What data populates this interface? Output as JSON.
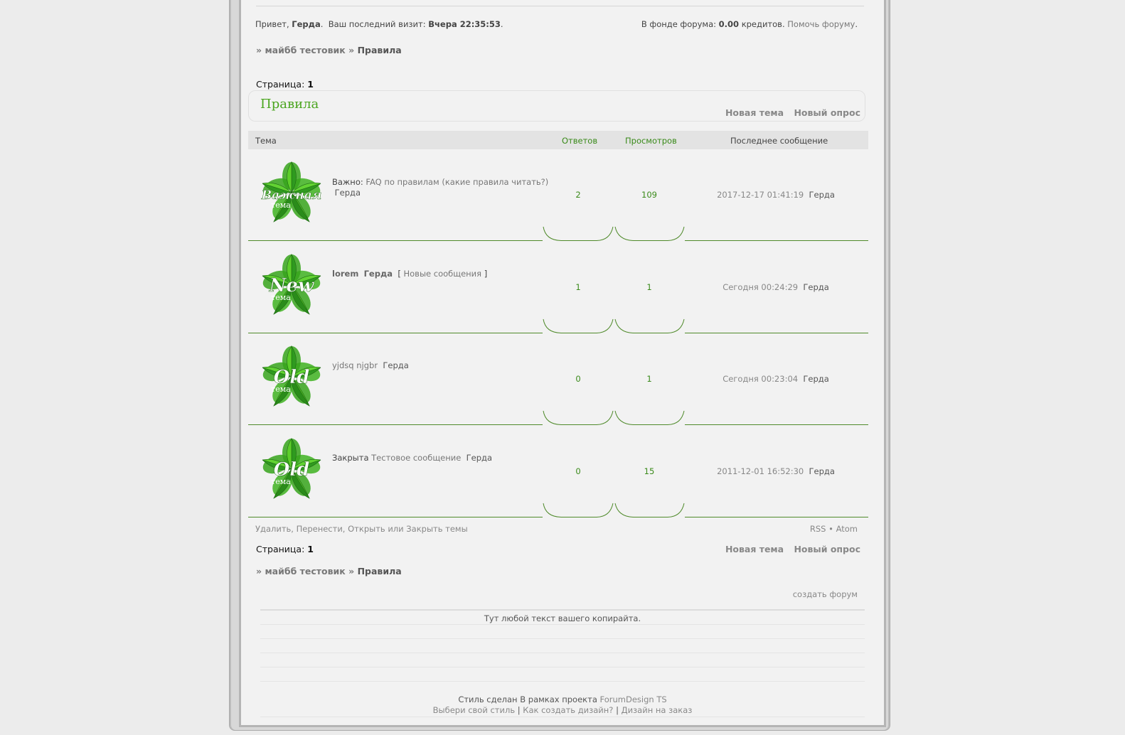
{
  "header": {
    "greeting_prefix": "Привет,",
    "user": "Герда",
    "last_visit_label": "Ваш последний визит:",
    "last_visit": "Вчера 22:35:53",
    "fund_label": "В фонде форума:",
    "fund_amount": "0.00",
    "fund_unit": "кредитов.",
    "help_link": "Помочь форуму"
  },
  "breadcrumb": {
    "sep": "»",
    "root": "майбб тестовик",
    "current": "Правила"
  },
  "pagination": {
    "label": "Страница:",
    "current": "1"
  },
  "forum": {
    "title": "Правила",
    "new_topic": "Новая тема",
    "new_poll": "Новый опрос"
  },
  "table": {
    "headers": {
      "topic": "Тема",
      "replies": "Ответов",
      "views": "Просмотров",
      "last_post": "Последнее сообщение"
    },
    "rows": [
      {
        "icon_word": "Важная",
        "icon_sub": "тема",
        "icon": "important-topic-leaf-icon",
        "prefix": "Важно:",
        "title": "FAQ по правилам (какие правила читать?)",
        "author": "Герда",
        "new_posts": "",
        "replies": "2",
        "views": "109",
        "last_date": "2017-12-17 01:41:19",
        "last_author": "Герда"
      },
      {
        "icon_word": "New",
        "icon_sub": "тема",
        "icon": "new-topic-leaf-icon",
        "prefix": "",
        "title": "lorem",
        "author": "Герда",
        "new_posts": "Новые сообщения",
        "replies": "1",
        "views": "1",
        "last_date": "Сегодня 00:24:29",
        "last_author": "Герда"
      },
      {
        "icon_word": "Old",
        "icon_sub": "тема",
        "icon": "old-topic-leaf-icon",
        "prefix": "",
        "title": "yjdsq njgbr",
        "author": "Герда",
        "new_posts": "",
        "replies": "0",
        "views": "1",
        "last_date": "Сегодня 00:23:04",
        "last_author": "Герда"
      },
      {
        "icon_word": "Old",
        "icon_sub": "тема",
        "icon": "old-topic-leaf-icon",
        "prefix": "Закрыта",
        "title": "Тестовое сообщение",
        "author": "Герда",
        "new_posts": "",
        "replies": "0",
        "views": "15",
        "last_date": "2011-12-01 16:52:30",
        "last_author": "Герда"
      }
    ]
  },
  "moderation": "Удалить, Перенести, Открыть или Закрыть темы",
  "feeds": {
    "rss": "RSS",
    "dot": "•",
    "atom": "Atom"
  },
  "create_forum": "создать форум",
  "footer": {
    "copyright": "Тут любой текст вашего копирайта.",
    "style_prefix": "Стиль сделан В рамках проекта",
    "style_link": "ForumDesign TS",
    "link1": "Выбери свой стиль",
    "link2": "Как создать дизайн?",
    "link3": "Дизайн на заказ",
    "bar": "|"
  },
  "colors": {
    "accent_green": "#4aa51f",
    "link_green": "#3a8a1a",
    "separator_green": "#4f8a2a"
  }
}
